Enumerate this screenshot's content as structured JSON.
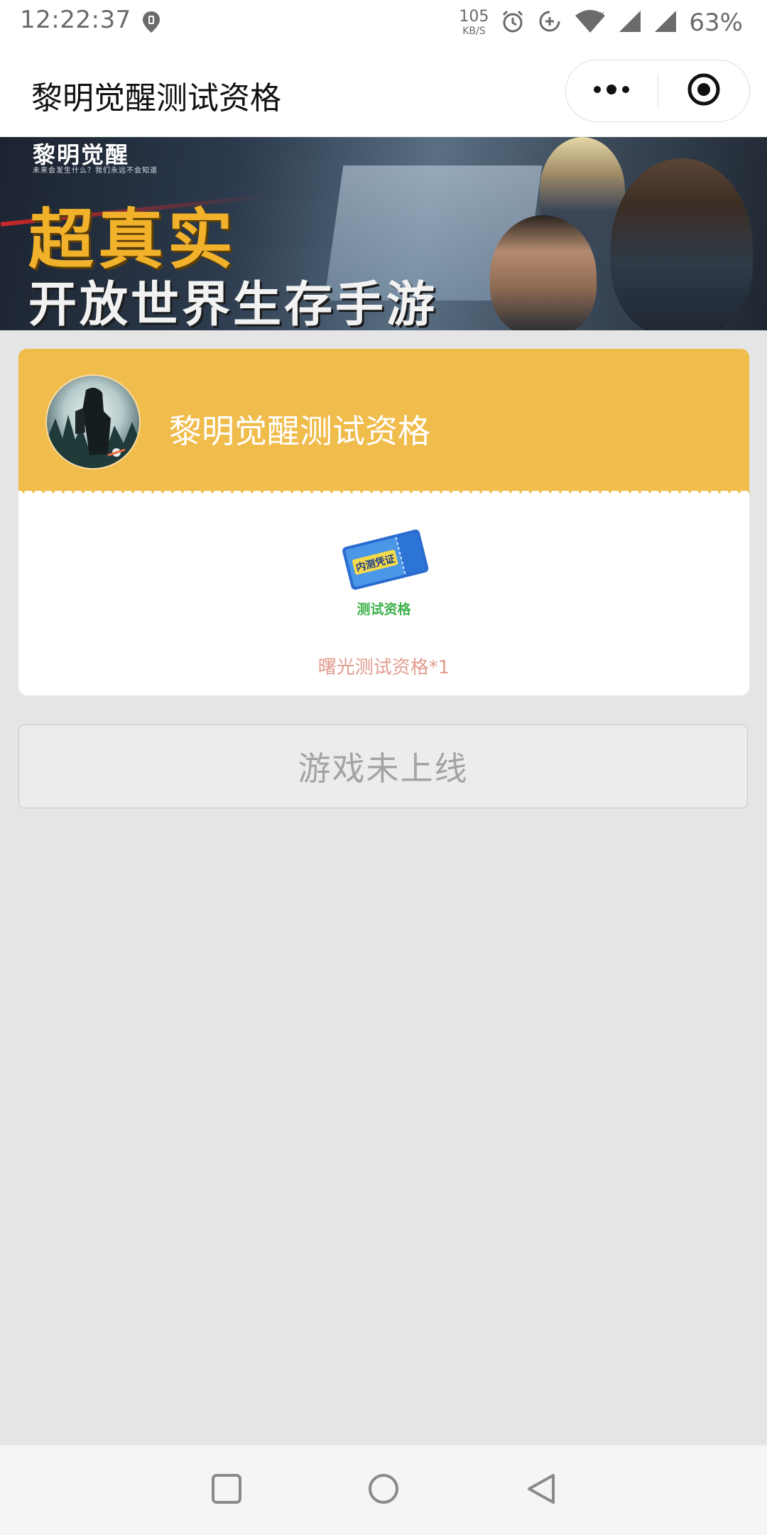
{
  "status_bar": {
    "time": "12:22:37",
    "net_speed_value": "105",
    "net_speed_unit": "KB/S",
    "battery": "63%",
    "icons": [
      "location-icon",
      "alarm-icon",
      "data-saver-icon",
      "wifi-icon",
      "signal-icon",
      "signal-icon"
    ]
  },
  "nav": {
    "title": "黎明觉醒测试资格",
    "more_icon": "more-dots-icon",
    "close_icon": "target-close-icon"
  },
  "banner": {
    "logo_text": "黎明觉醒",
    "logo_subtext": "未来会发生什么？我们永远不会知道",
    "headline": "超真实",
    "subline": "开放世界生存手游"
  },
  "card": {
    "title": "黎明觉醒测试资格",
    "header_color": "#f0bc4c",
    "ticket_text": "内测凭证",
    "reward_label": "测试资格",
    "reward_detail": "曙光测试资格*1"
  },
  "action_button": {
    "label": "游戏未上线"
  },
  "android_nav": {
    "icons": [
      "recents-square-icon",
      "home-circle-icon",
      "back-triangle-icon"
    ]
  },
  "colors": {
    "accent_yellow": "#f0bc4c",
    "reward_green": "#3fb24b",
    "reward_detail_pink": "#e29c8f",
    "background": "#e5e5e5"
  }
}
